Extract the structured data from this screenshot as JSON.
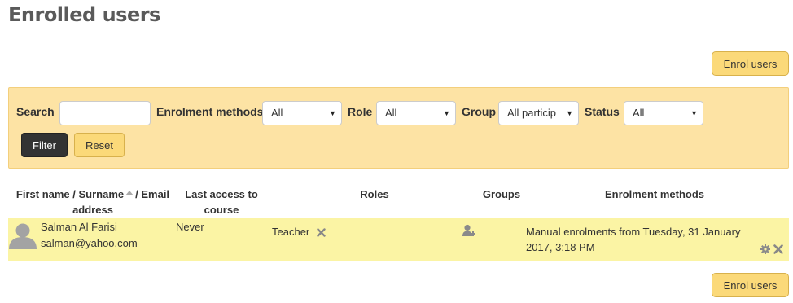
{
  "page": {
    "title": "Enrolled users"
  },
  "enrol_button": "Enrol users",
  "filter": {
    "search_label": "Search",
    "search_value": "",
    "methods_label": "Enrolment methods",
    "methods_value": "All",
    "role_label": "Role",
    "role_value": "All",
    "group_label": "Group",
    "group_value": "All particip",
    "status_label": "Status",
    "status_value": "All",
    "filter_button": "Filter",
    "reset_button": "Reset"
  },
  "table": {
    "headers": {
      "name_line1": "First name / Surname",
      "name_slash_email": "/ Email",
      "name_line2": "address",
      "access_line1": "Last access to",
      "access_line2": "course",
      "roles": "Roles",
      "groups": "Groups",
      "methods": "Enrolment methods"
    },
    "rows": [
      {
        "name": "Salman Al Farisi",
        "email": "salman@yahoo.com",
        "last_access": "Never",
        "role": "Teacher",
        "method_line1": "Manual enrolments from Tuesday, 31 January",
        "method_line2": "2017, 3:18 PM"
      }
    ]
  },
  "icons": {
    "remove_role": "close-icon",
    "add_group": "user-add-icon",
    "edit_enrolment": "gear-icon",
    "unenrol": "close-icon"
  },
  "colors": {
    "button_yellow": "#fbd979",
    "panel_bg": "#fde3a4",
    "row_highlight": "#fbf4a4",
    "filter_dark": "#333333"
  }
}
